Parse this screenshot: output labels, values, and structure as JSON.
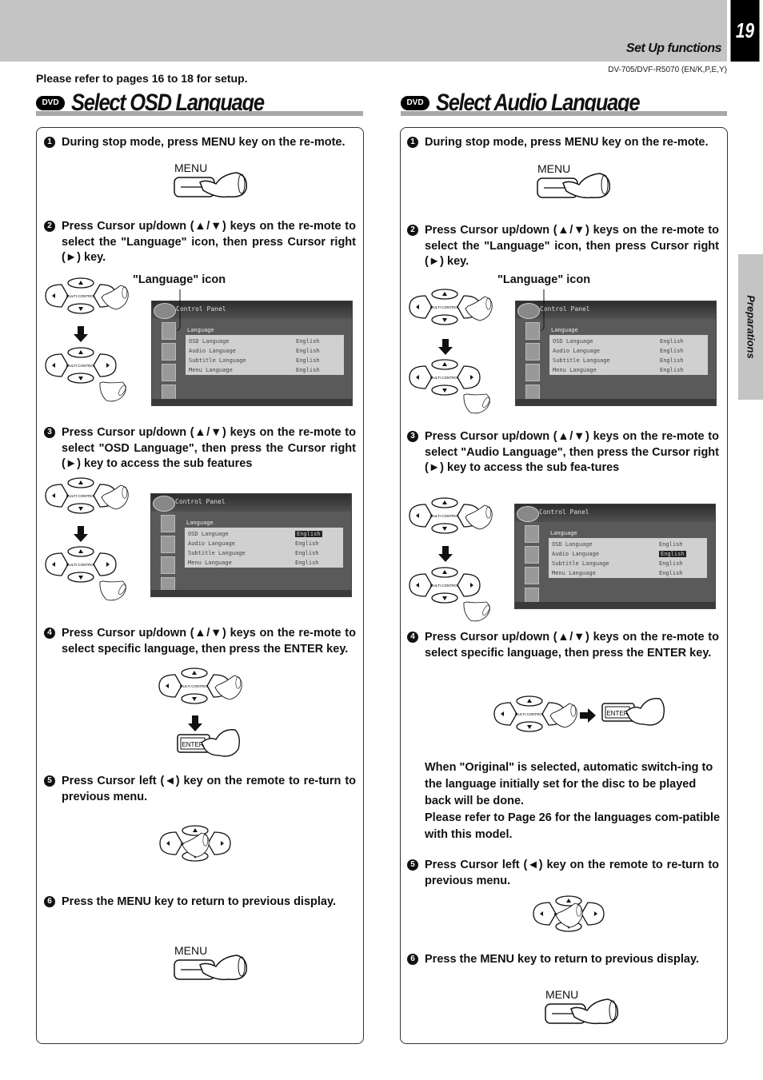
{
  "header": {
    "page_number": "19",
    "section": "Set Up functions",
    "model": "DV-705/DVF-R5070 (EN/K,P,E,Y)",
    "refer": "Please refer to pages 16 to 18 for setup.",
    "side_tab": "Preparations"
  },
  "badge": "DVD",
  "osd": {
    "title": "Select OSD Language",
    "steps": [
      {
        "num": "1",
        "text": "During stop mode, press MENU key on the re-mote."
      },
      {
        "num": "2",
        "text": "Press Cursor up/down (▲/▼) keys on the re-mote to select the \"Language\" icon, then press Cursor right (►) key."
      },
      {
        "num": "3",
        "text": "Press Cursor up/down (▲/▼) keys on the re-mote to select \"OSD Language\", then press the Cursor right (►) key to access the sub features"
      },
      {
        "num": "4",
        "text": "Press Cursor up/down (▲/▼) keys on the re-mote to select specific language, then press the ENTER key."
      },
      {
        "num": "5",
        "text": "Press Cursor left (◄) key on the remote to re-turn to previous menu."
      },
      {
        "num": "6",
        "text": "Press the MENU key to return to previous display."
      }
    ]
  },
  "audio": {
    "title": "Select Audio Language",
    "steps": [
      {
        "num": "1",
        "text": "During stop mode, press MENU key on the re-mote."
      },
      {
        "num": "2",
        "text": "Press Cursor up/down (▲/▼) keys on the re-mote to select the \"Language\" icon, then press Cursor right (►) key."
      },
      {
        "num": "3",
        "text": "Press Cursor up/down (▲/▼) keys on the re-mote to select \"Audio Language\", then press the Cursor right (►) key to access the sub fea-tures"
      },
      {
        "num": "4",
        "text": "Press Cursor up/down (▲/▼) keys on the re-mote to select specific language, then press the ENTER key."
      },
      {
        "num": "5",
        "text": "Press Cursor left (◄) key on the remote to re-turn to previous menu."
      },
      {
        "num": "6",
        "text": "Press the MENU key to return to previous display."
      }
    ],
    "note1": "When \"Original\" is selected, automatic switch-ing to the language initially set for the disc to be played back will be done.",
    "note2": "Please refer to Page 26 for the languages com-patible with this model."
  },
  "labels": {
    "menu": "MENU",
    "enter": "ENTER",
    "language_icon": "\"Language\" icon",
    "multi_control": "MULTI CONTROL"
  },
  "screen": {
    "header": "Control Panel",
    "section": "Language",
    "rows": [
      {
        "label": "OSD Language",
        "value": "English"
      },
      {
        "label": "Audio Language",
        "value": "English"
      },
      {
        "label": "Subtitle Language",
        "value": "English"
      },
      {
        "label": "Menu Language",
        "value": "English"
      }
    ]
  }
}
